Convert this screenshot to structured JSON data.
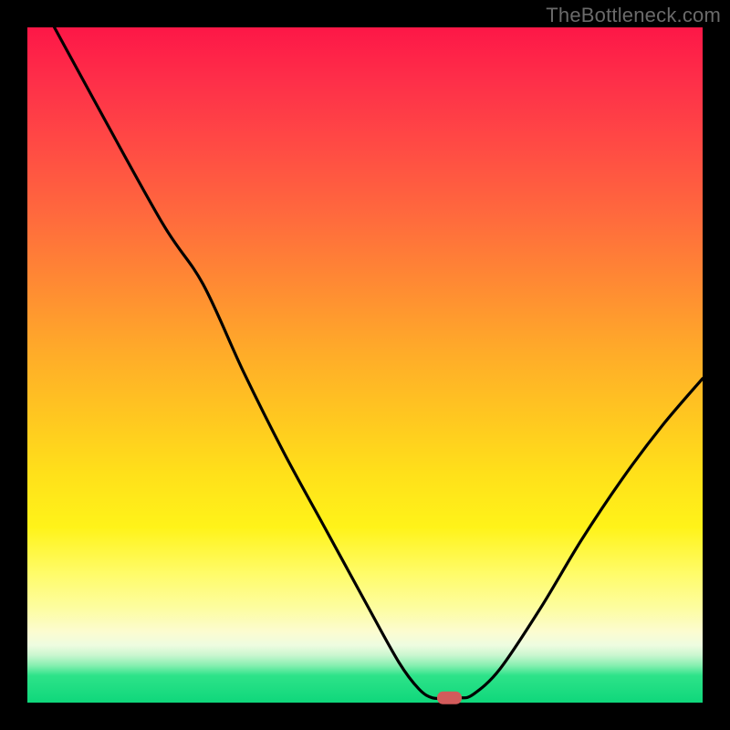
{
  "watermark": "TheBottleneck.com",
  "chart_data": {
    "type": "line",
    "title": "",
    "xlabel": "",
    "ylabel": "",
    "xlim": [
      0,
      100
    ],
    "ylim": [
      0,
      100
    ],
    "grid": false,
    "series": [
      {
        "name": "curve",
        "x": [
          4,
          10,
          20,
          26,
          32,
          38,
          44,
          50,
          55,
          58,
          60,
          62,
          64,
          66,
          70,
          76,
          82,
          88,
          94,
          100
        ],
        "y": [
          100,
          89,
          71,
          62,
          49,
          37,
          26,
          15,
          6,
          2,
          0.7,
          0.7,
          0.7,
          1.2,
          5,
          14,
          24,
          33,
          41,
          48
        ]
      }
    ],
    "marker": {
      "x": 62.5,
      "y": 0.7,
      "color": "#d35b5b",
      "shape": "rounded-rect"
    },
    "background_gradient_stops": [
      {
        "pos": 0,
        "color": "#fd1747"
      },
      {
        "pos": 0.38,
        "color": "#ff8a33"
      },
      {
        "pos": 0.66,
        "color": "#ffe01a"
      },
      {
        "pos": 0.86,
        "color": "#fdfda0"
      },
      {
        "pos": 0.93,
        "color": "#c9f6cf"
      },
      {
        "pos": 1.0,
        "color": "#0fd77b"
      }
    ]
  }
}
